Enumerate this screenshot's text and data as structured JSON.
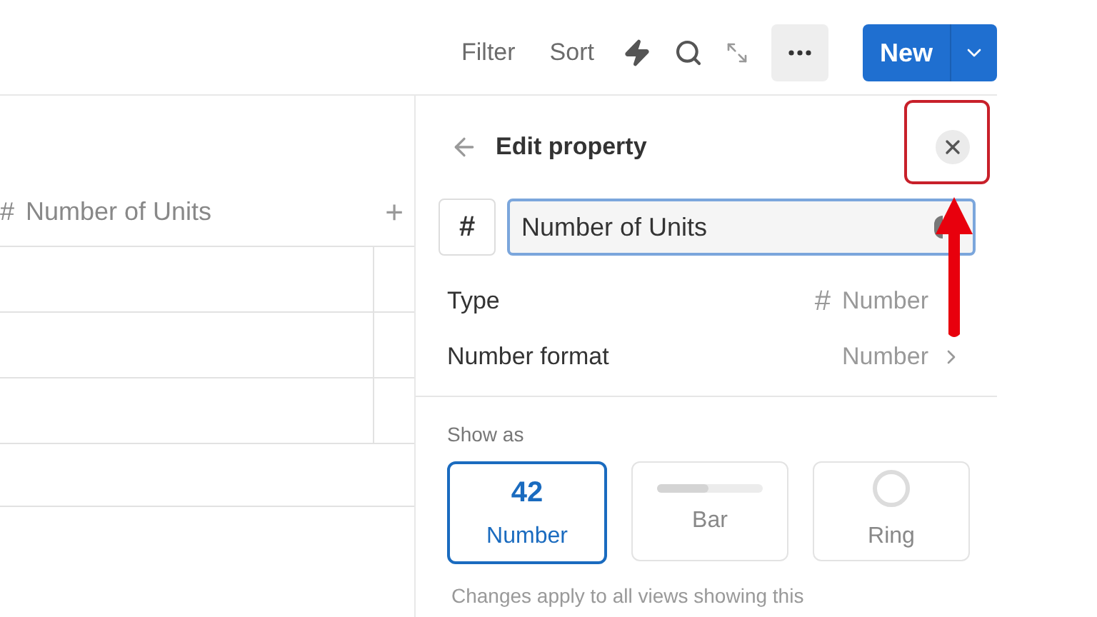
{
  "toolbar": {
    "items": [
      {
        "kind": "text",
        "label": "Filter"
      },
      {
        "kind": "text",
        "label": "Sort"
      },
      {
        "kind": "automation"
      },
      {
        "kind": "search"
      },
      {
        "kind": "expand"
      },
      {
        "kind": "more"
      }
    ],
    "new_button": "New"
  },
  "table": {
    "columns": [
      {
        "label": "Number of Units",
        "icon": "#"
      }
    ],
    "add_column": "+"
  },
  "panel": {
    "title": "Edit property",
    "type_icon": "#",
    "name_field": {
      "value": "Number of Units"
    },
    "properties": [
      {
        "label": "Type",
        "icon": "#",
        "value": "Number",
        "chevron": false
      },
      {
        "label": "Number format",
        "value": "Number",
        "chevron": true
      }
    ],
    "show_as_label": "Show as",
    "options": [
      {
        "kind": "number",
        "preview": "42",
        "label": "Number",
        "selected": true
      },
      {
        "kind": "bar",
        "label": "Bar",
        "selected": false
      },
      {
        "kind": "ring",
        "label": "Ring",
        "selected": false
      }
    ],
    "note": "Changes apply to all views showing this"
  },
  "annotation": {
    "highlight": true,
    "arrow": true
  }
}
